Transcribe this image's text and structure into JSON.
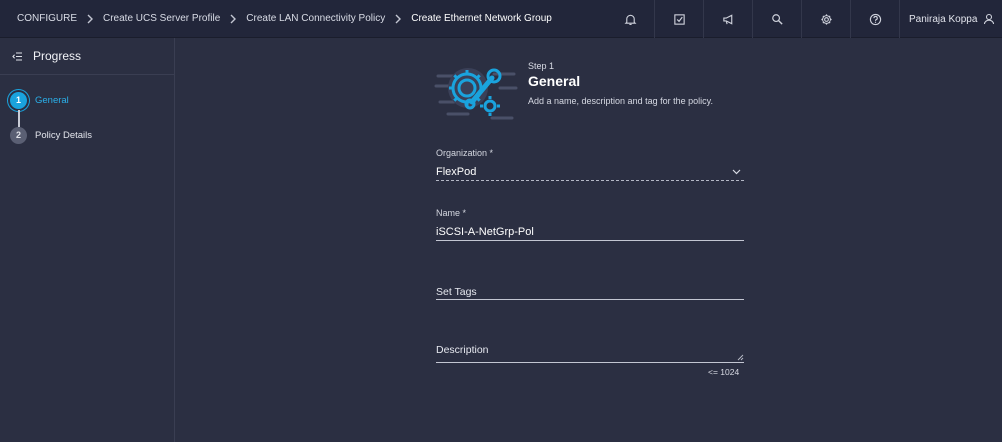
{
  "breadcrumb": {
    "items": [
      "CONFIGURE",
      "Create UCS Server Profile",
      "Create LAN Connectivity Policy",
      "Create Ethernet Network Group"
    ]
  },
  "topbar": {
    "icons": [
      "bell-icon",
      "task-check-icon",
      "megaphone-icon",
      "search-icon",
      "gear-icon",
      "help-icon"
    ],
    "user_name": "Paniraja Koppa"
  },
  "sidebar": {
    "title": "Progress",
    "steps": [
      {
        "number": "1",
        "label": "General",
        "state": "active"
      },
      {
        "number": "2",
        "label": "Policy Details",
        "state": "inactive"
      }
    ]
  },
  "step": {
    "label": "Step 1",
    "title": "General",
    "description": "Add a name, description and tag for the policy."
  },
  "form": {
    "organization": {
      "label": "Organization *",
      "value": "FlexPod"
    },
    "name": {
      "label": "Name *",
      "value": "iSCSI-A-NetGrp-Pol"
    },
    "tags": {
      "placeholder": "Set Tags"
    },
    "description": {
      "placeholder": "Description",
      "limit": "<= 1024"
    }
  },
  "colors": {
    "background": "#2b2f42",
    "topbar": "#22263a",
    "accent": "#1aa3dd"
  }
}
